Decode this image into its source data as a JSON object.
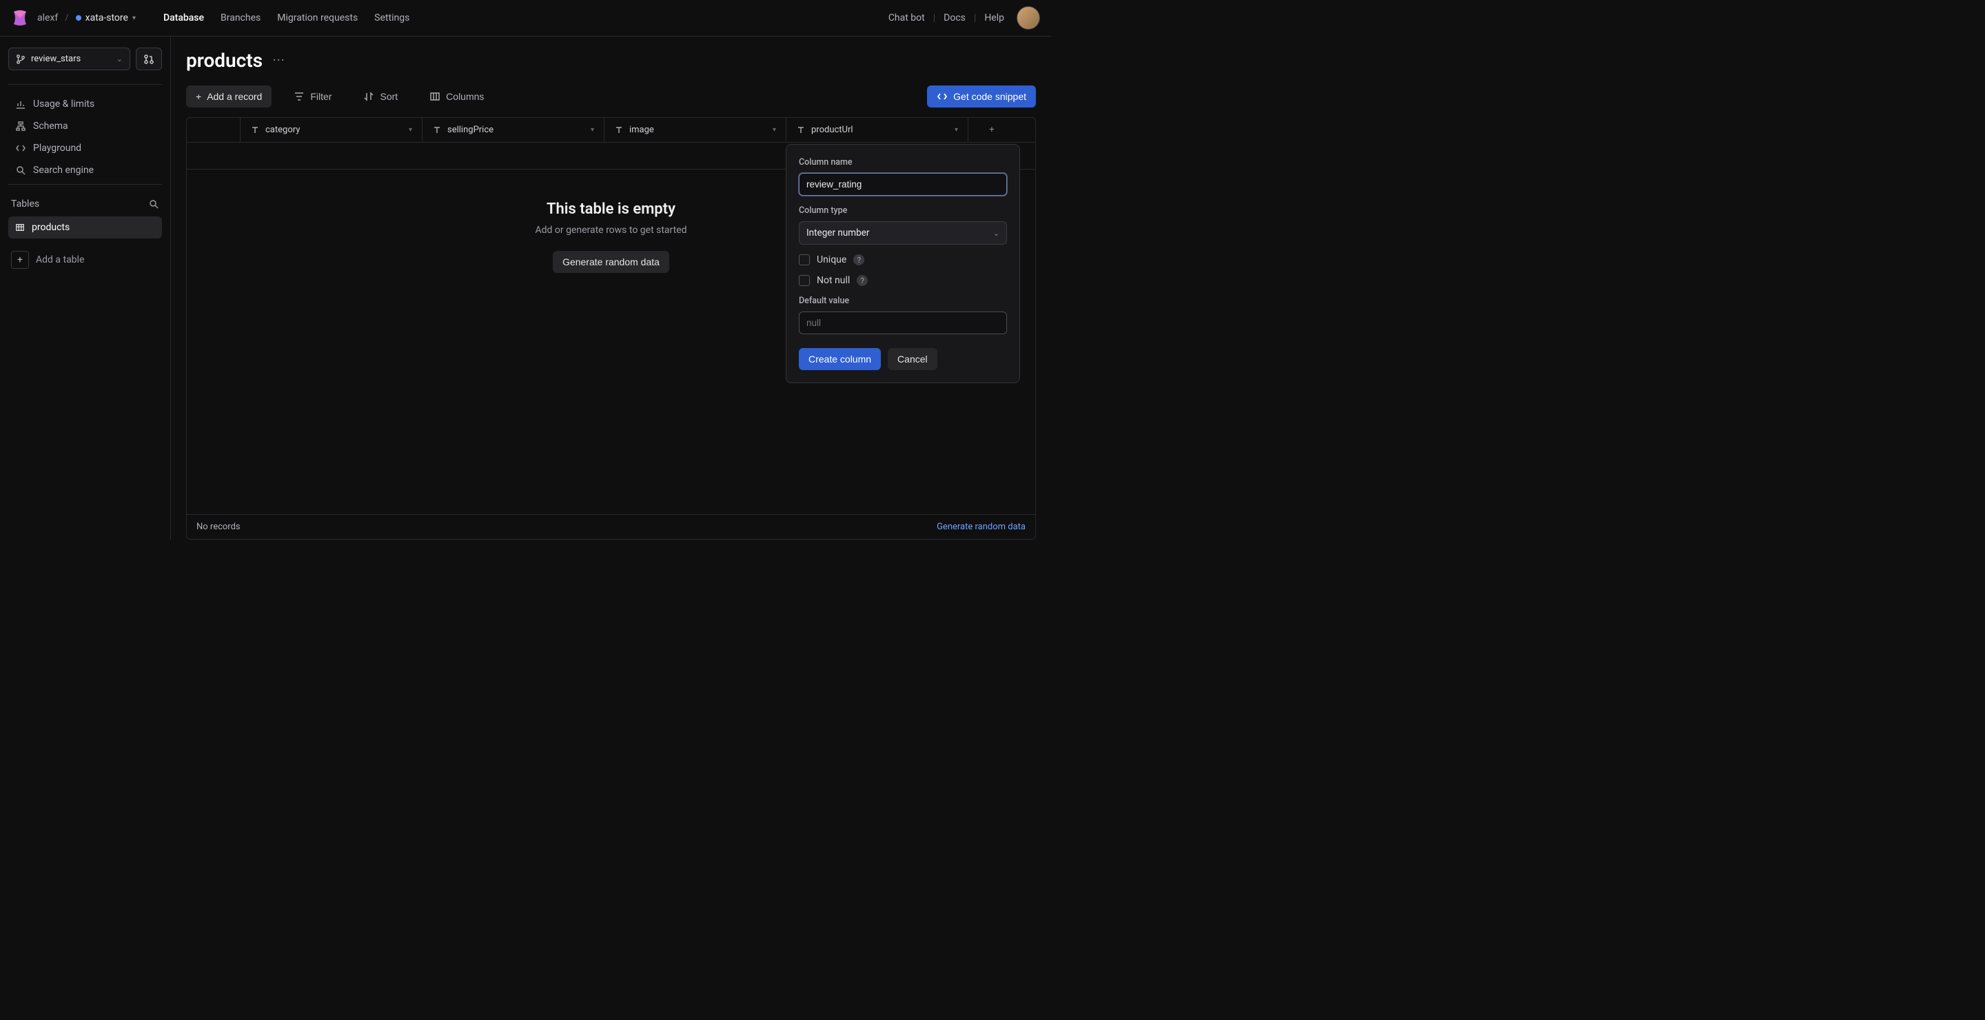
{
  "header": {
    "workspace": "alexf",
    "store": "xata-store",
    "nav": {
      "database": "Database",
      "branches": "Branches",
      "migrations": "Migration requests",
      "settings": "Settings"
    },
    "right": {
      "chat": "Chat bot",
      "docs": "Docs",
      "help": "Help"
    }
  },
  "sidebar": {
    "branch": "review_stars",
    "items": {
      "usage": "Usage & limits",
      "schema": "Schema",
      "playground": "Playground",
      "search": "Search engine"
    },
    "tables_label": "Tables",
    "tables": {
      "products": "products"
    },
    "add_table": "Add a table"
  },
  "main": {
    "title": "products",
    "toolbar": {
      "add_record": "Add a record",
      "filter": "Filter",
      "sort": "Sort",
      "columns": "Columns",
      "snippet": "Get code snippet"
    },
    "columns": {
      "category": "category",
      "sellingPrice": "sellingPrice",
      "image": "image",
      "productUrl": "productUrl"
    },
    "empty": {
      "title": "This table is empty",
      "subtitle": "Add or generate rows to get started",
      "button": "Generate random data"
    },
    "footer": {
      "count": "No records",
      "generate": "Generate random data"
    }
  },
  "popover": {
    "name_label": "Column name",
    "name_value": "review_rating",
    "type_label": "Column type",
    "type_value": "Integer number",
    "unique": "Unique",
    "notnull": "Not null",
    "default_label": "Default value",
    "default_placeholder": "null",
    "create": "Create column",
    "cancel": "Cancel"
  }
}
